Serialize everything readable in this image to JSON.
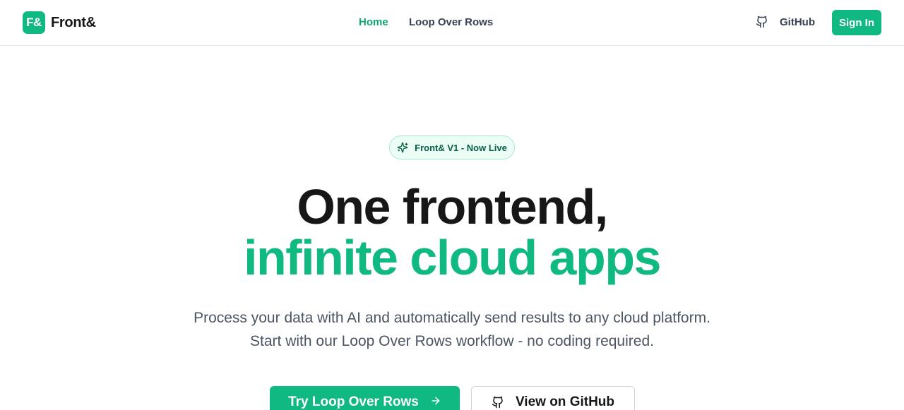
{
  "brand": {
    "mark": "F&",
    "name": "Front&",
    "accent_color": "#10b981"
  },
  "nav": {
    "items": [
      {
        "label": "Home",
        "active": true
      },
      {
        "label": "Loop Over Rows",
        "active": false
      }
    ]
  },
  "header_actions": {
    "github_label": "GitHub",
    "github_icon": "github-icon",
    "signin_label": "Sign In"
  },
  "hero": {
    "badge": {
      "icon": "sparkles-icon",
      "text": "Front& V1 - Now Live"
    },
    "headline_line1": "One frontend,",
    "headline_line2": "infinite cloud apps",
    "subtitle_line1": "Process your data with AI and automatically send results to any cloud platform.",
    "subtitle_line2": "Start with our Loop Over Rows workflow - no coding required.",
    "primary_cta": {
      "label": "Try Loop Over Rows",
      "icon": "arrow-right-icon"
    },
    "secondary_cta": {
      "label": "View on GitHub",
      "icon": "github-icon"
    }
  }
}
